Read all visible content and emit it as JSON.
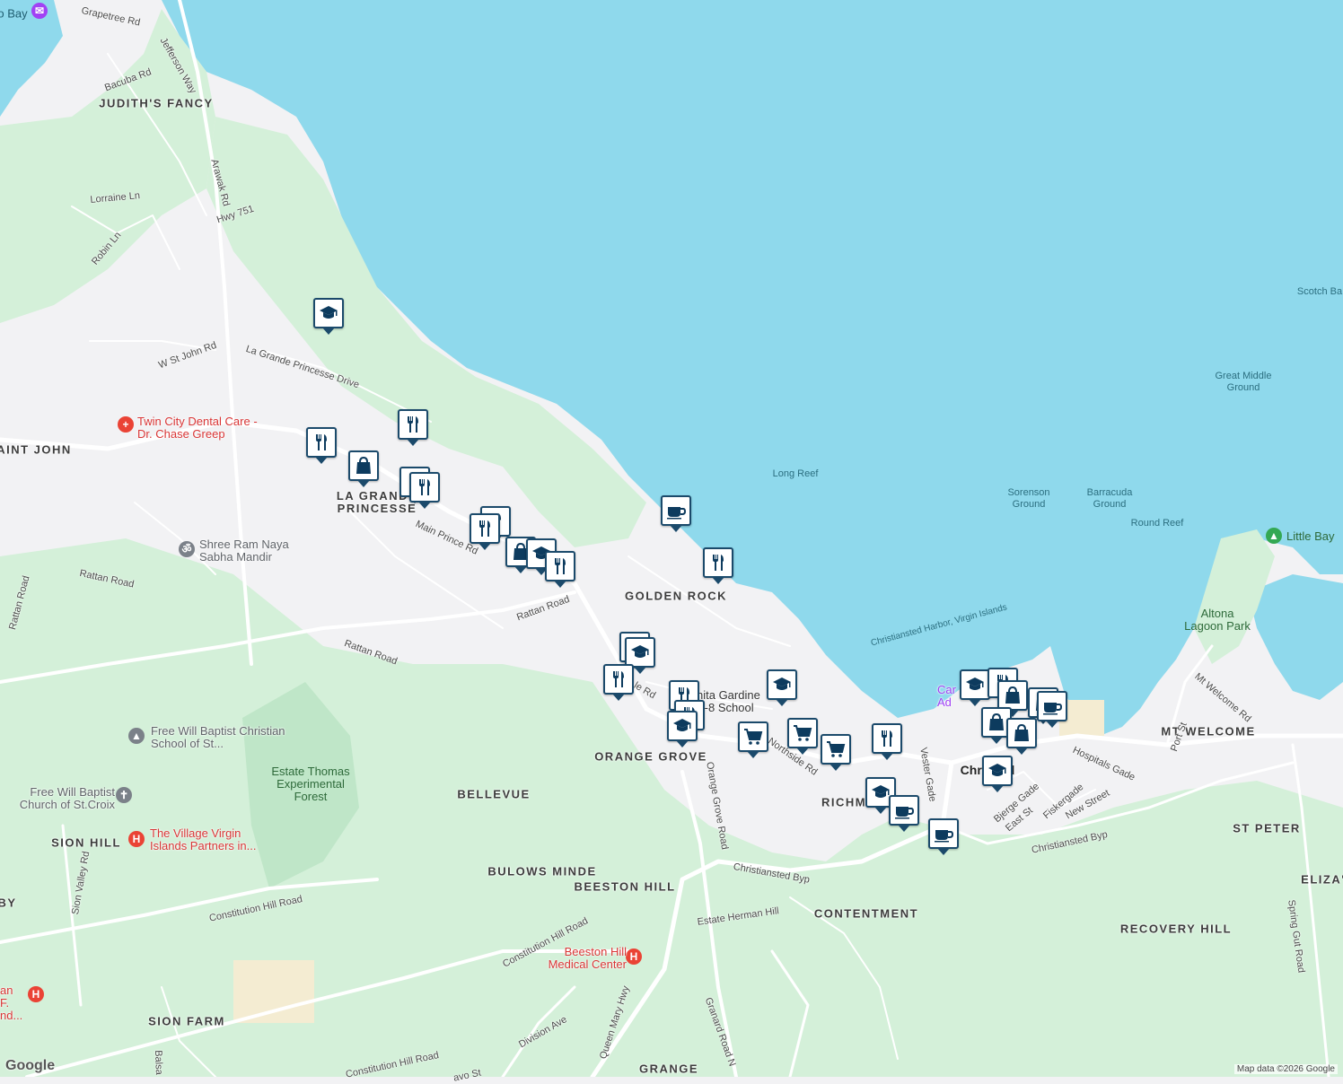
{
  "colors": {
    "water": "#8fd9ec",
    "land": "#f2f2f4",
    "park": "#d4f0d9",
    "road": "#ffffff",
    "pin_border": "#1b4a6b",
    "pin_icon": "#0d3b5e"
  },
  "areas": [
    "JUDITH'S FANCY",
    "AINT JOHN",
    "LA GRANDE PRINCESSE",
    "GOLDEN ROCK",
    "ORANGE GROVE",
    "BELLEVUE",
    "SION HILL",
    "BULOWS MINDE",
    "BEESTON HILL",
    "CONTENTMENT",
    "RECOVERY HILL",
    "MT WELCOME",
    "ST PETER",
    "ELIZA'",
    "SION FARM",
    "GRANGE",
    "RICHM",
    "BY"
  ],
  "roads": [
    "Grapetree Rd",
    "Jefferson Way",
    "Bacuba Rd",
    "Arawak Rd",
    "Hwy 751",
    "Lorraine Ln",
    "Robin Ln",
    "W St John Rd",
    "La Grande Princesse Drive",
    "Main Prince Rd",
    "Rattan Road",
    "Rattan Road",
    "Rattan Road",
    "Rattan Road",
    "Northside Rd",
    "Orange Grove Road",
    "Vester Gade",
    "Christiansted Byp",
    "Christiansted Byp",
    "Hospitals Gade",
    "Port St",
    "Mt Welcome Rd",
    "Bjerge Gade",
    "East St",
    "Fiskergade",
    "New Street",
    "Estate Herman Hill",
    "Constitution Hill Road",
    "Constitution Hill Road",
    "Constitution Hill Road",
    "Division Ave",
    "Queen Mary Hwy",
    "Granard Road N",
    "Sion Valley Rd",
    "Spring Gut Road",
    "Balsa",
    "avo St",
    "le Rd"
  ],
  "water_labels": [
    "Scotch Ba",
    "Great Middle Ground",
    "Long Reef",
    "Sorenson Ground",
    "Barracuda Ground",
    "Round Reef",
    "Christiansted Harbor, Virgin Islands",
    "o Bay"
  ],
  "pois": {
    "dental": "Twin City Dental Care - Dr. Chase Greep",
    "mandir": "Shree Ram Naya Sabha Mandir",
    "fwb_school": "Free Will Baptist Christian School of St...",
    "fwb_church": "Free Will Baptist Church of St.Croix",
    "forest": "Estate Thomas Experimental Forest",
    "village": "The Village Virgin Islands Partners in...",
    "beeston": "Beeston Hill Medical Center",
    "little_bay": "Little Bay",
    "altona": "Altona Lagoon Park",
    "juanita": "nita Gardine K-8 School",
    "christiansted": "Christ ed",
    "carambola": "Car Ad",
    "juan": "an F. nd..."
  },
  "markers": [
    "school",
    "restaurant",
    "restaurant",
    "shopping",
    "restaurant",
    "restaurant",
    "restaurant",
    "restaurant",
    "shopping",
    "school",
    "restaurant",
    "cafe",
    "restaurant",
    "restaurant",
    "school",
    "restaurant",
    "restaurant",
    "restaurant",
    "school",
    "school",
    "grocery",
    "grocery",
    "grocery",
    "restaurant",
    "school",
    "cafe",
    "school",
    "restaurant",
    "shopping",
    "shopping",
    "shopping",
    "cafe",
    "shopping",
    "school",
    "cafe"
  ],
  "footer": {
    "logo": "Google",
    "credit": "Map data ©2026 Google"
  }
}
